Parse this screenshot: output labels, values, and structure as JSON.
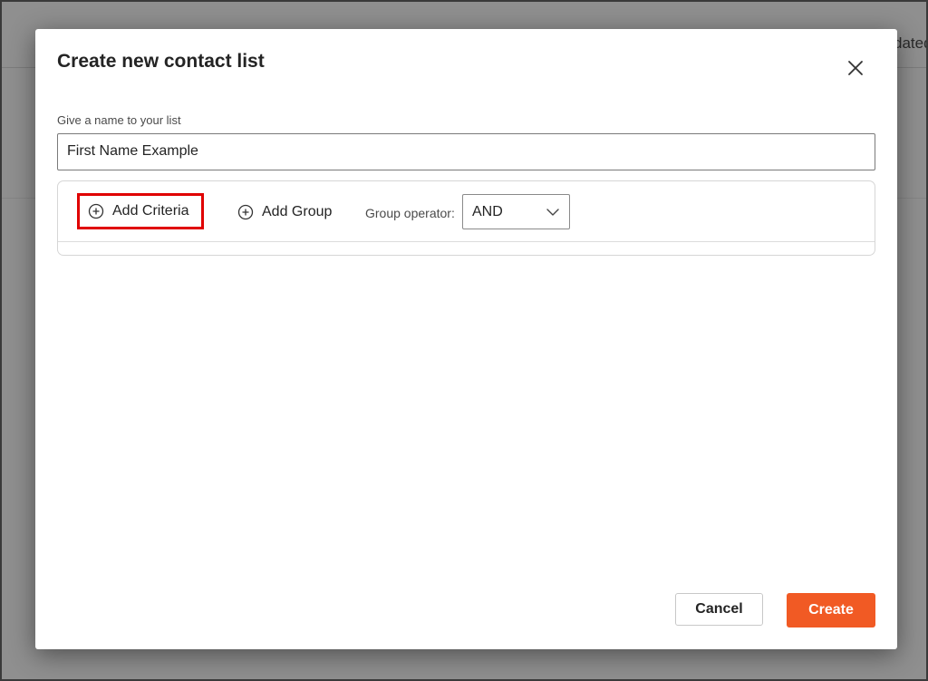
{
  "background": {
    "column_header_fragment": "dated"
  },
  "dialog": {
    "title": "Create new contact list",
    "close_icon": "close-icon",
    "name_field": {
      "label": "Give a name to your list",
      "value": "First Name Example"
    },
    "criteria": {
      "add_criteria_label": "Add Criteria",
      "add_criteria_icon": "plus-circle-icon",
      "add_group_label": "Add Group",
      "add_group_icon": "plus-circle-icon",
      "group_operator_label": "Group operator:",
      "group_operator_value": "AND",
      "dropdown_icon": "chevron-down-icon"
    },
    "footer": {
      "cancel_label": "Cancel",
      "create_label": "Create"
    }
  },
  "colors": {
    "accent": "#f15a24",
    "highlight_box": "#e00000",
    "overlay": "#8f8f8f"
  }
}
